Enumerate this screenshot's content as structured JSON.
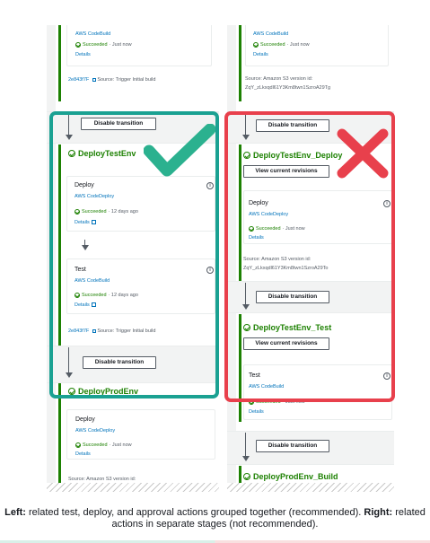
{
  "left": {
    "top_card": {
      "name_fragment": "ild",
      "provider": "AWS CodeBuild",
      "status": "Succeeded",
      "time": "Just now",
      "details": "Details"
    },
    "top_source": {
      "commit": "2e843f7F",
      "text": "Source: Trigger Initial build"
    },
    "disable_transition_1": "Disable transition",
    "stage_deploy_test": "DeployTestEnv",
    "deploy_card": {
      "name": "Deploy",
      "provider": "AWS CodeDeploy",
      "status": "Succeeded",
      "time": "12 days ago",
      "details": "Details",
      "info": "i"
    },
    "test_card": {
      "name": "Test",
      "provider": "AWS CodeBuild",
      "status": "Succeeded",
      "time": "12 days ago",
      "details": "Details",
      "info": "i"
    },
    "bottom_source": {
      "commit": "2e843f7F",
      "text": "Source: Trigger Initial build"
    },
    "disable_transition_2": "Disable transition",
    "stage_deploy_prod": "DeployProdEnv",
    "prod_card": {
      "name": "Deploy",
      "provider": "AWS CodeDeploy",
      "status": "Succeeded",
      "time": "Just now",
      "details": "Details"
    },
    "prod_source": "Source: Amazon S3 version id:"
  },
  "right": {
    "top_card": {
      "name_fragment": "ild",
      "provider": "AWS CodeBuild",
      "status": "Succeeded",
      "time": "Just now",
      "details": "Details"
    },
    "top_source": {
      "label": "Source: Amazon S3 version id:",
      "id": "ZqY_zLkxqdl61Y3Km8twn1SzroA29Tg"
    },
    "disable_transition_1": "Disable transition",
    "stage_deploy": "DeployTestEnv_Deploy",
    "view_revisions_1": "View current revisions",
    "deploy_card": {
      "name": "Deploy",
      "provider": "AWS CodeDeploy",
      "status": "Succeeded",
      "time": "Just now",
      "details": "Details",
      "info": "i"
    },
    "deploy_source": {
      "label": "Source: Amazon S3 version id:",
      "id": "ZqY_zLkxqdl61Y3Km8twn1SzroA29To"
    },
    "disable_transition_2": "Disable transition",
    "stage_test": "DeployTestEnv_Test",
    "view_revisions_2": "View current revisions",
    "test_card": {
      "name": "Test",
      "provider": "AWS CodeBuild",
      "status": "Succeeded",
      "time": "Just now",
      "details": "Details",
      "info": "i"
    },
    "disable_transition_3": "Disable transition",
    "stage_build": "DeployProdEnv_Build"
  },
  "marks": {
    "left": "checkmark-icon",
    "right": "cross-icon",
    "left_color": "#2bb18f",
    "right_color": "#e8404c"
  },
  "caption": {
    "left_bold": "Left:",
    "left_text": " related test, deploy, and approval actions grouped together (recommended).",
    "right_bold": "Right:",
    "right_text": " related actions in separate stages (not recommended)."
  }
}
